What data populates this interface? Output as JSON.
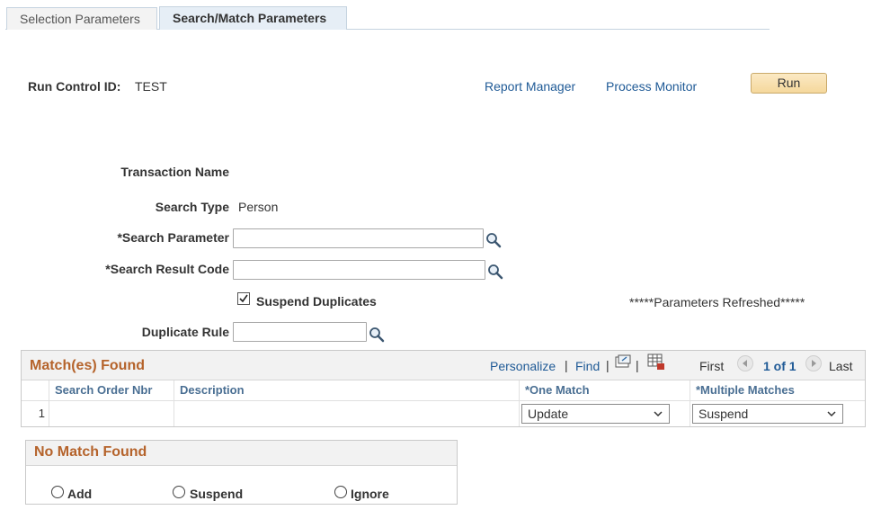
{
  "tabs": [
    {
      "label": "Selection Parameters",
      "active": false
    },
    {
      "label": "Search/Match Parameters",
      "active": true
    }
  ],
  "header": {
    "run_control_label": "Run Control ID:",
    "run_control_value": "TEST",
    "report_manager": "Report Manager",
    "process_monitor": "Process Monitor",
    "run_label": "Run"
  },
  "form": {
    "transaction_name_label": "Transaction Name",
    "search_type_label": "Search Type",
    "search_type_value": "Person",
    "search_parameter_label": "*Search Parameter",
    "search_parameter_value": "",
    "search_result_code_label": "*Search Result Code",
    "search_result_code_value": "",
    "suspend_duplicates_label": "Suspend Duplicates",
    "suspend_duplicates_checked": true,
    "parameters_refreshed": "*****Parameters Refreshed*****",
    "duplicate_rule_label": "Duplicate Rule",
    "duplicate_rule_value": ""
  },
  "matches_grid": {
    "title": "Match(es) Found",
    "personalize": "Personalize",
    "find": "Find",
    "separator": "|",
    "first": "First",
    "range": "1 of 1",
    "last": "Last",
    "columns": [
      "Search Order Nbr",
      "Description",
      "*One Match",
      "*Multiple Matches"
    ],
    "rows": [
      {
        "num": "1",
        "search_order_nbr": "",
        "description": "",
        "one_match": "Update",
        "multiple_matches": "Suspend"
      }
    ]
  },
  "no_match": {
    "title": "No Match Found",
    "options": [
      "Add",
      "Suspend",
      "Ignore"
    ],
    "selected": null
  },
  "colors": {
    "accent_title": "#b5632b",
    "link": "#1f5a96",
    "column_header": "#4a6f93"
  }
}
